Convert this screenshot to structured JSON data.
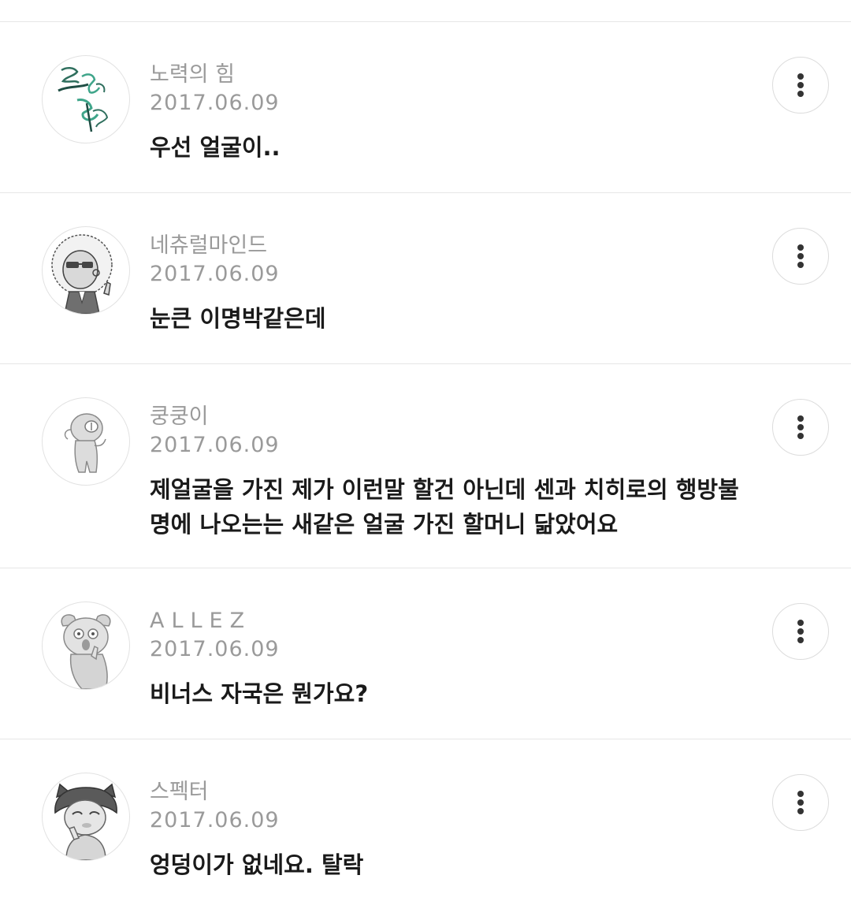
{
  "comments": [
    {
      "author": "노력의 힘",
      "date": "2017.06.09",
      "text": "우선 얼굴이..",
      "avatar_icon": "calligraphy-avatar"
    },
    {
      "author": "네츄럴마인드",
      "date": "2017.06.09",
      "text": "눈큰 이명박같은데",
      "avatar_icon": "afro-sunglasses-avatar"
    },
    {
      "author": "쿵쿵이",
      "date": "2017.06.09",
      "text": "제얼굴을 가진 제가 이런말 할건 아닌데 센과 치히로의 행방불명에 나오는는 새같은 얼굴 가진 할머니 닮았어요",
      "avatar_icon": "cyclops-character-avatar"
    },
    {
      "author": "ALLEZ",
      "date": "2017.06.09",
      "text": "비너스 자국은 뭔가요?",
      "avatar_icon": "dog-character-avatar"
    },
    {
      "author": "스펙터",
      "date": "2017.06.09",
      "text": "엉덩이가 없네요. 탈락",
      "avatar_icon": "cat-girl-avatar"
    }
  ],
  "more_button_icon": "vertical-ellipsis-icon"
}
